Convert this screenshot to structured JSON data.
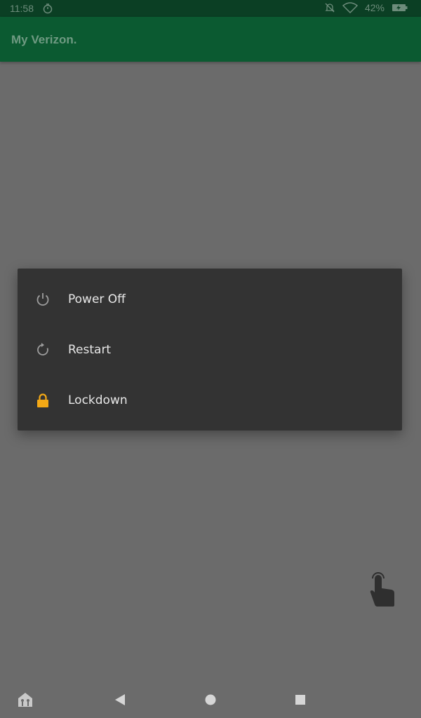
{
  "status_bar": {
    "time": "11:58",
    "battery": "42%",
    "icons": [
      "timer-icon",
      "notifications-off-icon",
      "wifi-icon",
      "battery-charging-icon"
    ]
  },
  "app_bar": {
    "title": "My Verizon."
  },
  "power_menu": {
    "items": [
      {
        "label": "Power Off",
        "icon": "power-icon"
      },
      {
        "label": "Restart",
        "icon": "restart-icon"
      },
      {
        "label": "Lockdown",
        "icon": "lock-icon"
      }
    ]
  },
  "nav_bar": {
    "icons": [
      "home-launcher-icon",
      "back-icon",
      "home-icon",
      "recents-icon"
    ]
  },
  "colors": {
    "status_bar": "#0b3f24",
    "app_bar": "#0b5a31",
    "scrim": "#6b6b6b",
    "dialog": "#333333",
    "lock_accent": "#f4a916"
  }
}
